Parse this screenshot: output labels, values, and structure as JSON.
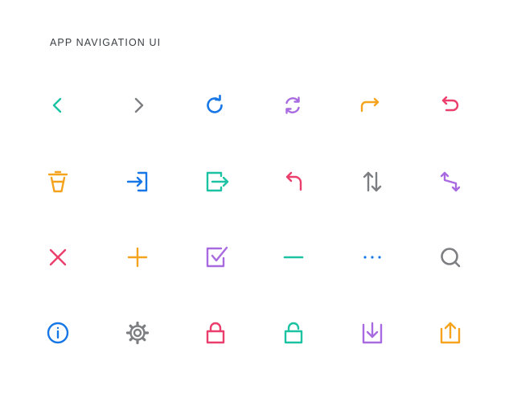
{
  "header": {
    "title": "APP NAVIGATION UI"
  },
  "palette": {
    "teal": "#1BC3A3",
    "gray": "#7C7E82",
    "blue": "#1877E6",
    "purple": "#A86AE0",
    "orange": "#F5A31D",
    "pink": "#EC3E6C"
  },
  "icons": [
    {
      "name": "chevron-left-icon",
      "color": "#1BC3A3"
    },
    {
      "name": "chevron-right-icon",
      "color": "#7C7E82"
    },
    {
      "name": "refresh-icon",
      "color": "#1877E6"
    },
    {
      "name": "sync-icon",
      "color": "#A86AE0"
    },
    {
      "name": "redo-icon",
      "color": "#F5A31D"
    },
    {
      "name": "undo-icon",
      "color": "#EC3E6C"
    },
    {
      "name": "trash-icon",
      "color": "#F5A31D"
    },
    {
      "name": "login-icon",
      "color": "#1877E6"
    },
    {
      "name": "logout-icon",
      "color": "#1BC3A3"
    },
    {
      "name": "reply-icon",
      "color": "#EC3E6C"
    },
    {
      "name": "sort-icon",
      "color": "#7C7E82"
    },
    {
      "name": "swap-icon",
      "color": "#A86AE0"
    },
    {
      "name": "close-icon",
      "color": "#EC3E6C"
    },
    {
      "name": "plus-icon",
      "color": "#F5A31D"
    },
    {
      "name": "checkbox-icon",
      "color": "#A86AE0"
    },
    {
      "name": "minus-icon",
      "color": "#1BC3A3"
    },
    {
      "name": "more-icon",
      "color": "#1877E6"
    },
    {
      "name": "search-icon",
      "color": "#7C7E82"
    },
    {
      "name": "info-icon",
      "color": "#1877E6"
    },
    {
      "name": "gear-icon",
      "color": "#7C7E82"
    },
    {
      "name": "lock-icon",
      "color": "#EC3E6C"
    },
    {
      "name": "unlock-icon",
      "color": "#1BC3A3"
    },
    {
      "name": "download-icon",
      "color": "#A86AE0"
    },
    {
      "name": "upload-icon",
      "color": "#F5A31D"
    }
  ]
}
